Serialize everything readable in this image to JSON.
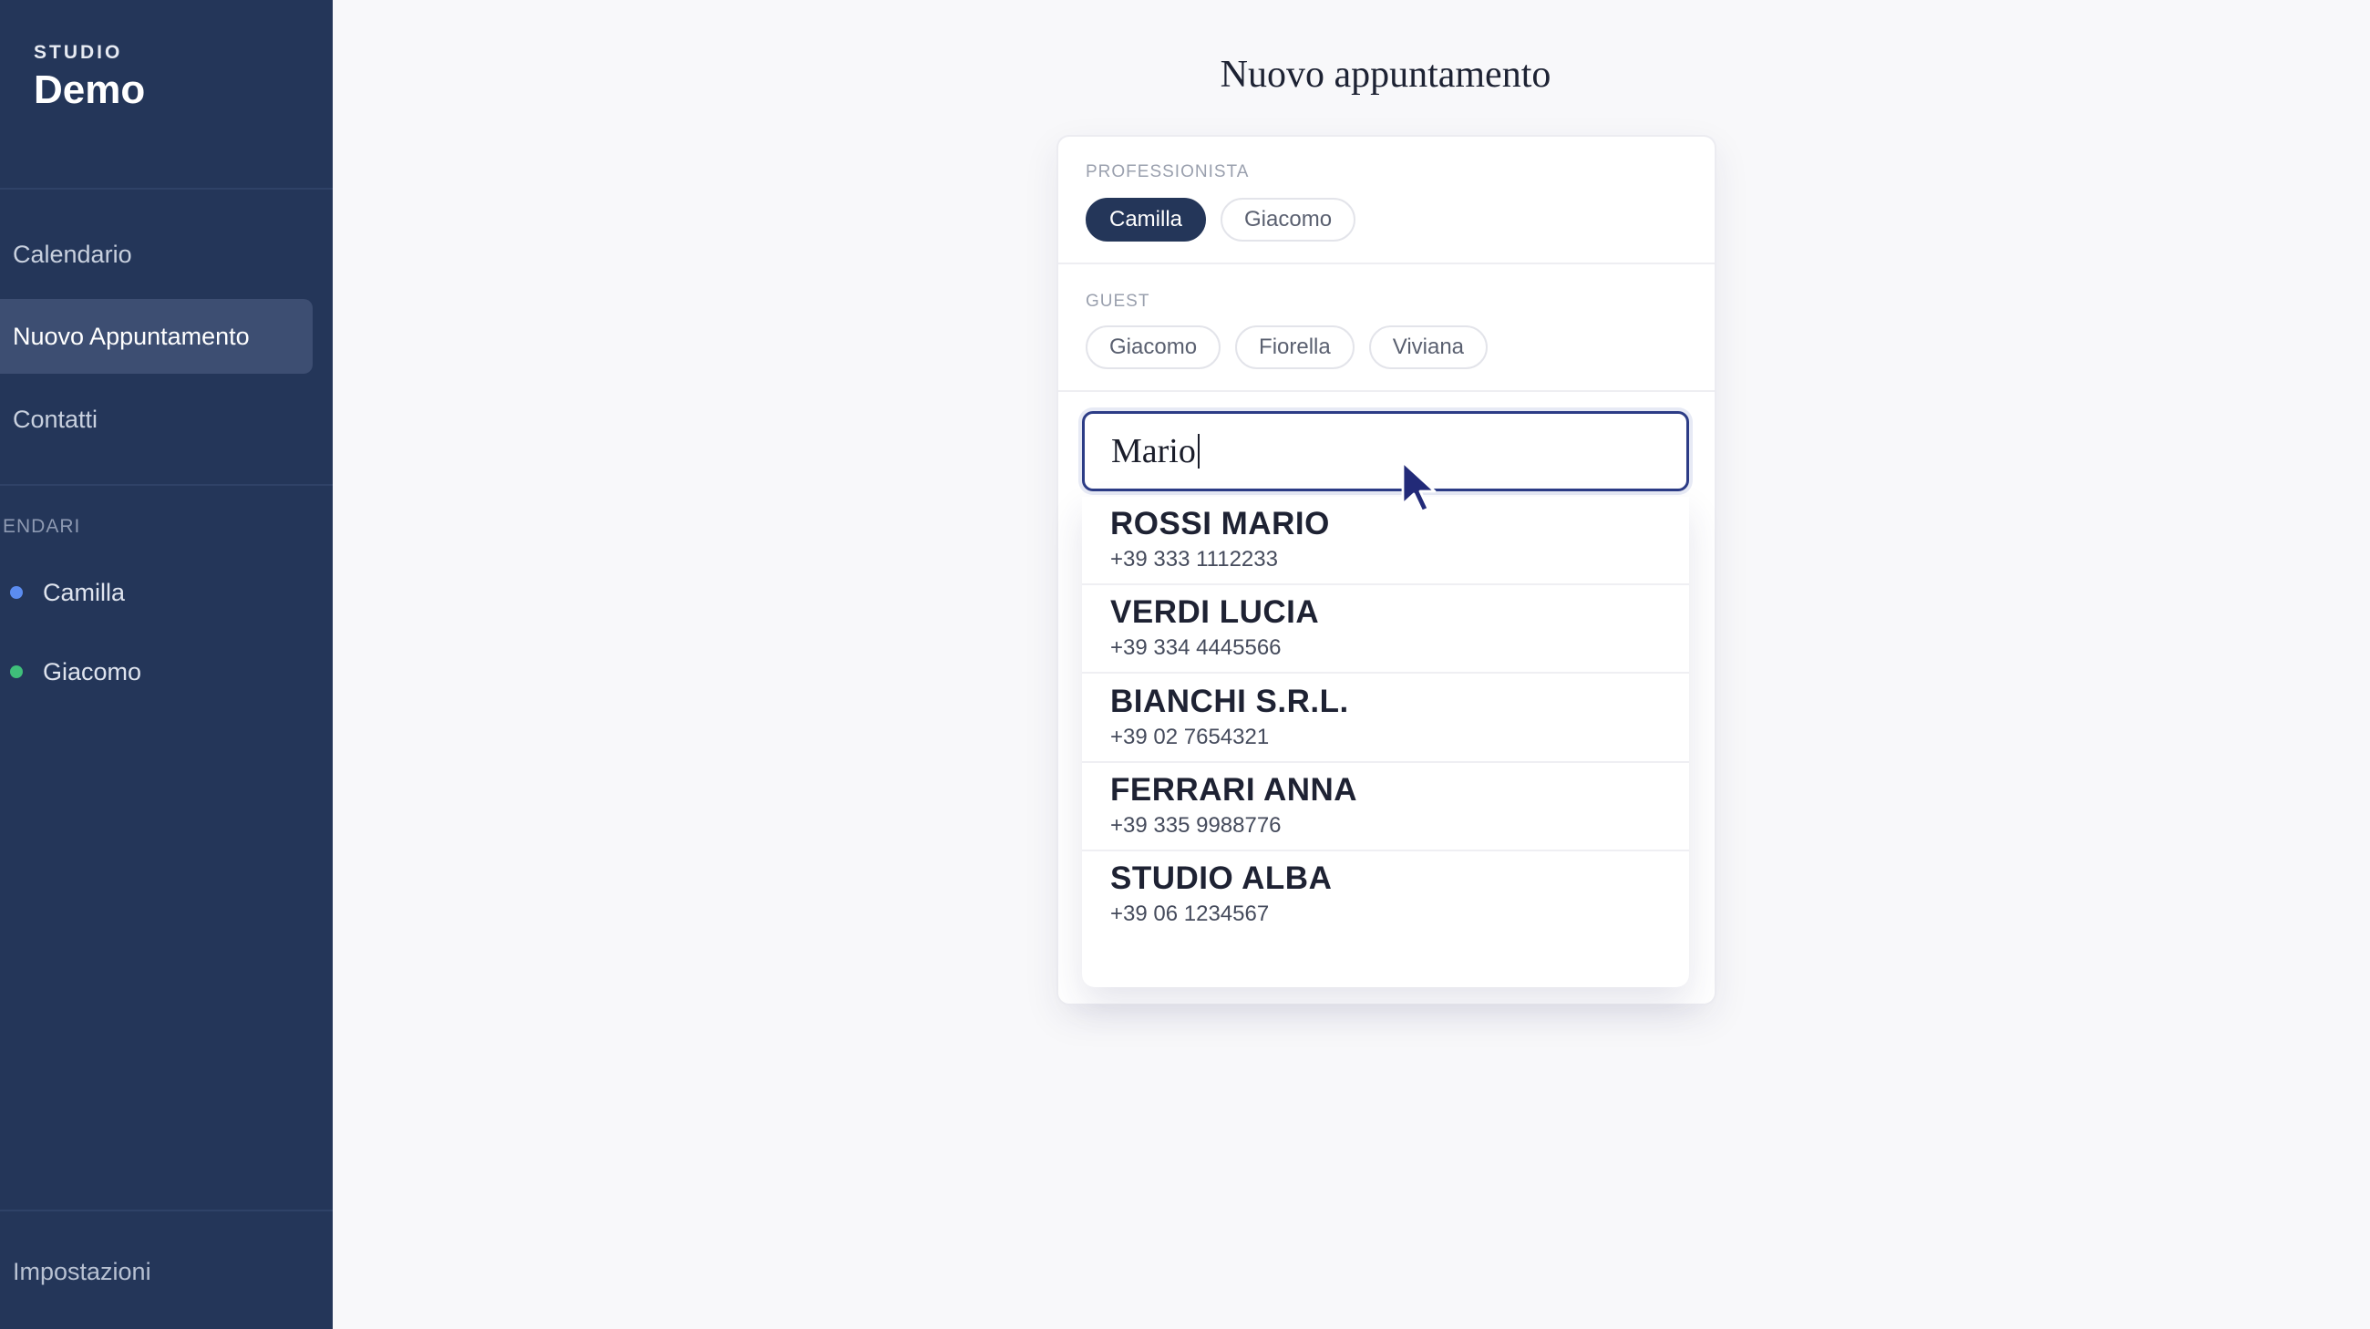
{
  "sidebar": {
    "brand_small": "STUDIO",
    "brand_name": "Demo",
    "nav": [
      {
        "label": "Calendario"
      },
      {
        "label": "Nuovo Appuntamento"
      },
      {
        "label": "Contatti"
      }
    ],
    "calendars_section_label": "ENDARI",
    "calendars": [
      {
        "label": "Camilla",
        "color": "#5b8cf0"
      },
      {
        "label": "Giacomo",
        "color": "#3fbf7a"
      }
    ],
    "settings_label": "Impostazioni"
  },
  "main": {
    "title": "Nuovo appuntamento",
    "professional_label": "PROFESSIONISTA",
    "professionals": [
      "Camilla",
      "Giacomo"
    ],
    "selected_professional": "Camilla",
    "guest_label": "GUEST",
    "guests": [
      "Giacomo",
      "Fiorella",
      "Viviana"
    ],
    "search_value": "Mario",
    "results": [
      {
        "name": "ROSSI MARIO",
        "phone": "+39 333 1112233"
      },
      {
        "name": "VERDI LUCIA",
        "phone": "+39 334 4445566"
      },
      {
        "name": "BIANCHI S.R.L.",
        "phone": "+39 02 7654321"
      },
      {
        "name": "FERRARI ANNA",
        "phone": "+39 335 9988776"
      },
      {
        "name": "STUDIO ALBA",
        "phone": "+39 06 1234567"
      }
    ]
  },
  "colors": {
    "sidebar_bg": "#243659",
    "accent": "#243659",
    "focus_ring": "#2c3c86"
  },
  "icons": {
    "cursor": "mouse-pointer-icon"
  }
}
